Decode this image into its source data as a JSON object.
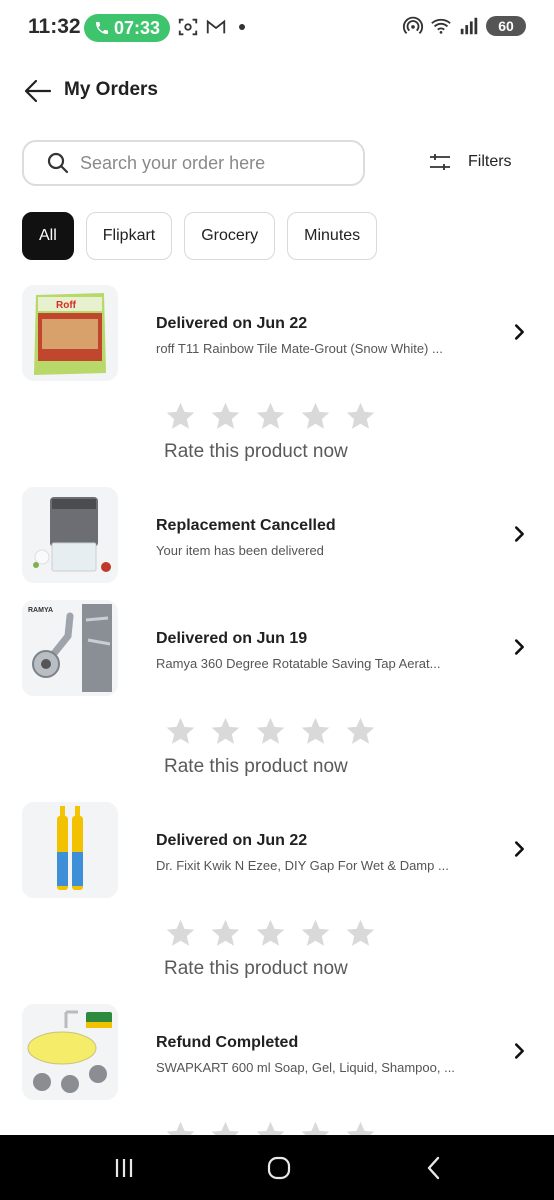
{
  "status_bar": {
    "time": "11:32",
    "call_timer": "07:33",
    "battery": "60",
    "accent_call": "#3ec46d"
  },
  "header": {
    "title": "My Orders",
    "back_icon": "arrow-left-icon"
  },
  "search": {
    "placeholder": "Search your order here",
    "value": "",
    "filters_label": "Filters"
  },
  "chips": [
    "All",
    "Flipkart",
    "Grocery",
    "Minutes"
  ],
  "active_chip": "All",
  "orders": [
    {
      "status": "Delivered on Jun 22",
      "desc": "roff T11 Rainbow Tile Mate-Grout (Snow White) ...",
      "rating_prompt": "Rate this product now"
    },
    {
      "status": "Replacement Cancelled",
      "desc": "Your item has been delivered"
    },
    {
      "status": "Delivered on Jun 19",
      "desc": "Ramya 360 Degree Rotatable Saving Tap Aerat...",
      "rating_prompt": "Rate this product now"
    },
    {
      "status": "Delivered on Jun 22",
      "desc": "Dr. Fixit Kwik N Ezee, DIY Gap For Wet & Damp ...",
      "rating_prompt": "Rate this product now"
    },
    {
      "status": "Refund Completed",
      "desc": "SWAPKART 600 ml Soap, Gel, Liquid, Shampoo, ..."
    }
  ],
  "product_label_roff": "Roff",
  "product_label_ramya": "RAMYA",
  "star_color": "#d9d9d9"
}
